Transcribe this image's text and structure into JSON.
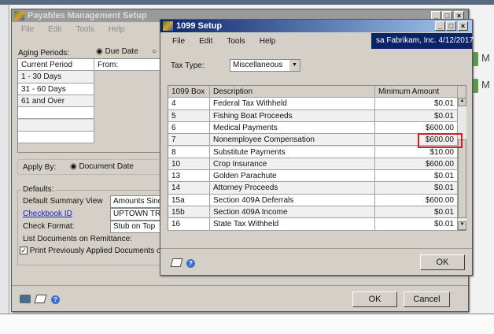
{
  "payables": {
    "title": "Payables Management Setup",
    "menu": [
      "File",
      "Edit",
      "Tools",
      "Help"
    ],
    "aging_label": "Aging Periods:",
    "due_date": "Due Date",
    "from_label": "From:",
    "aging_rows": [
      "Current Period",
      "1 - 30 Days",
      "31 - 60 Days",
      "61 and Over",
      "",
      "",
      ""
    ],
    "apply_by_label": "Apply By:",
    "apply_by_value": "Document Date",
    "defaults_label": "Defaults:",
    "default_summary_label": "Default Summary View",
    "default_summary_value": "Amounts Since",
    "checkbook_label": "Checkbook ID",
    "checkbook_value": "UPTOWN TRU",
    "check_format_label": "Check Format:",
    "check_format_value": "Stub on Top",
    "list_docs_label": "List Documents on Remittance:",
    "print_prev_label": "Print Previously Applied Documents on Re",
    "print_prev_checked": true,
    "ok": "OK",
    "cancel": "Cancel"
  },
  "setup1099": {
    "title": "1099 Setup",
    "menu": [
      "File",
      "Edit",
      "Tools",
      "Help"
    ],
    "user_info": "sa  Fabrikam, Inc.  4/12/2017",
    "tax_type_label": "Tax Type:",
    "tax_type_value": "Miscellaneous",
    "columns": [
      "1099 Box",
      "Description",
      "Minimum Amount"
    ],
    "rows": [
      {
        "box": "4",
        "desc": "Federal Tax Withheld",
        "amt": "$0.01"
      },
      {
        "box": "5",
        "desc": "Fishing Boat Proceeds",
        "amt": "$0.01"
      },
      {
        "box": "6",
        "desc": "Medical Payments",
        "amt": "$600.00"
      },
      {
        "box": "7",
        "desc": "Nonemployee Compensation",
        "amt": "$600.00"
      },
      {
        "box": "8",
        "desc": "Substitute Payments",
        "amt": "$10.00"
      },
      {
        "box": "10",
        "desc": "Crop Insurance",
        "amt": "$600.00"
      },
      {
        "box": "13",
        "desc": "Golden Parachute",
        "amt": "$0.01"
      },
      {
        "box": "14",
        "desc": "Attorney Proceeds",
        "amt": "$0.01"
      },
      {
        "box": "15a",
        "desc": "Section 409A Deferrals",
        "amt": "$600.00"
      },
      {
        "box": "15b",
        "desc": "Section 409A Income",
        "amt": "$0.01"
      },
      {
        "box": "16",
        "desc": "State Tax Withheld",
        "amt": "$0.01"
      }
    ],
    "highlight_color": "#d02020",
    "ok": "OK"
  },
  "background": {
    "right_labels": [
      "M",
      "M"
    ]
  }
}
